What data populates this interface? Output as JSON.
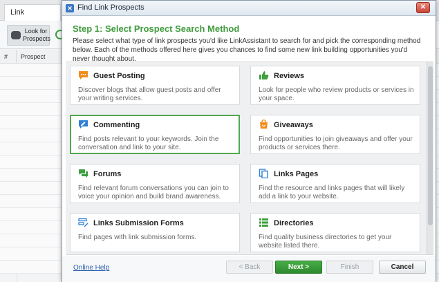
{
  "background": {
    "tab_label": "Link Prospects",
    "toolbar_button_label": "Look for Prospects",
    "columns": [
      "#",
      "Prospect Domain"
    ]
  },
  "dialog": {
    "title": "Find Link Prospects",
    "close_glyph": "✕",
    "step_title": "Step 1: Select Prospect Search Method",
    "step_description": "Please select what type of link prospects you'd like LinkAssistant to search for and pick the corresponding method below. Each of the methods offered here gives you chances to find some new link building opportunities you'd never thought about.",
    "methods": [
      {
        "title": "Guest Posting",
        "description": "Discover blogs that allow guest posts and offer your writing services.",
        "icon": "chat-bubble-icon",
        "color": "#f28c1b",
        "selected": false
      },
      {
        "title": "Reviews",
        "description": "Look for people who review products or services in your space.",
        "icon": "thumbs-up-icon",
        "color": "#3d9f3d",
        "selected": false
      },
      {
        "title": "Commenting",
        "description": "Find posts relevant to your keywords. Join the conversation and link to your site.",
        "icon": "comment-pen-icon",
        "color": "#2f7fd6",
        "selected": true
      },
      {
        "title": "Giveaways",
        "description": "Find opportunities to join giveaways and offer your products or services there.",
        "icon": "shopping-bag-icon",
        "color": "#f28c1b",
        "selected": false
      },
      {
        "title": "Forums",
        "description": "Find relevant forum conversations you can join to voice your opinion and build brand awareness.",
        "icon": "forum-bubbles-icon",
        "color": "#3d9f3d",
        "selected": false
      },
      {
        "title": "Links Pages",
        "description": "Find the resource and links pages that will likely add a link to your website.",
        "icon": "pages-icon",
        "color": "#2f7fd6",
        "selected": false
      },
      {
        "title": "Links Submission Forms",
        "description": "Find pages with link submission forms.",
        "icon": "form-pen-icon",
        "color": "#2f7fd6",
        "selected": false
      },
      {
        "title": "Directories",
        "description": "Find quality business directories to get your website listed there.",
        "icon": "list-icon",
        "color": "#3d9f3d",
        "selected": false
      }
    ],
    "footer": {
      "help_link": "Online Help",
      "back_label": "< Back",
      "next_label": "Next >",
      "finish_label": "Finish",
      "cancel_label": "Cancel"
    }
  }
}
